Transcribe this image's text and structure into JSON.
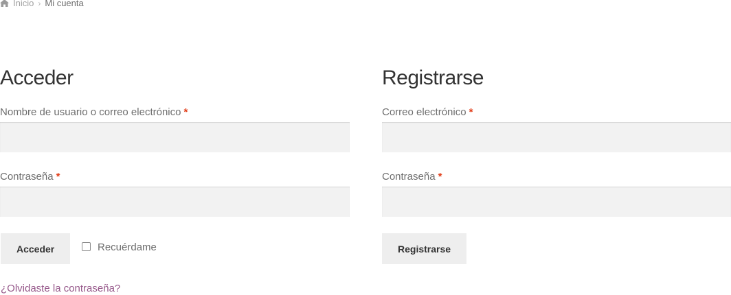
{
  "breadcrumb": {
    "home": "Inicio",
    "separator": "›",
    "current": "Mi cuenta"
  },
  "login": {
    "title": "Acceder",
    "username_label": "Nombre de usuario o correo electrónico",
    "password_label": "Contraseña",
    "required_mark": "*",
    "username_value": "",
    "password_value": "",
    "submit_label": "Acceder",
    "remember_label": "Recuérdame",
    "remember_checked": false,
    "lost_password": "¿Olvidaste la contraseña?"
  },
  "register": {
    "title": "Registrarse",
    "email_label": "Correo electrónico",
    "password_label": "Contraseña",
    "required_mark": "*",
    "email_value": "",
    "password_value": "",
    "submit_label": "Registrarse"
  },
  "colors": {
    "link": "#96588a",
    "required": "#e2401c",
    "input_bg": "#f2f2f2",
    "button_bg": "#eeeeee"
  }
}
